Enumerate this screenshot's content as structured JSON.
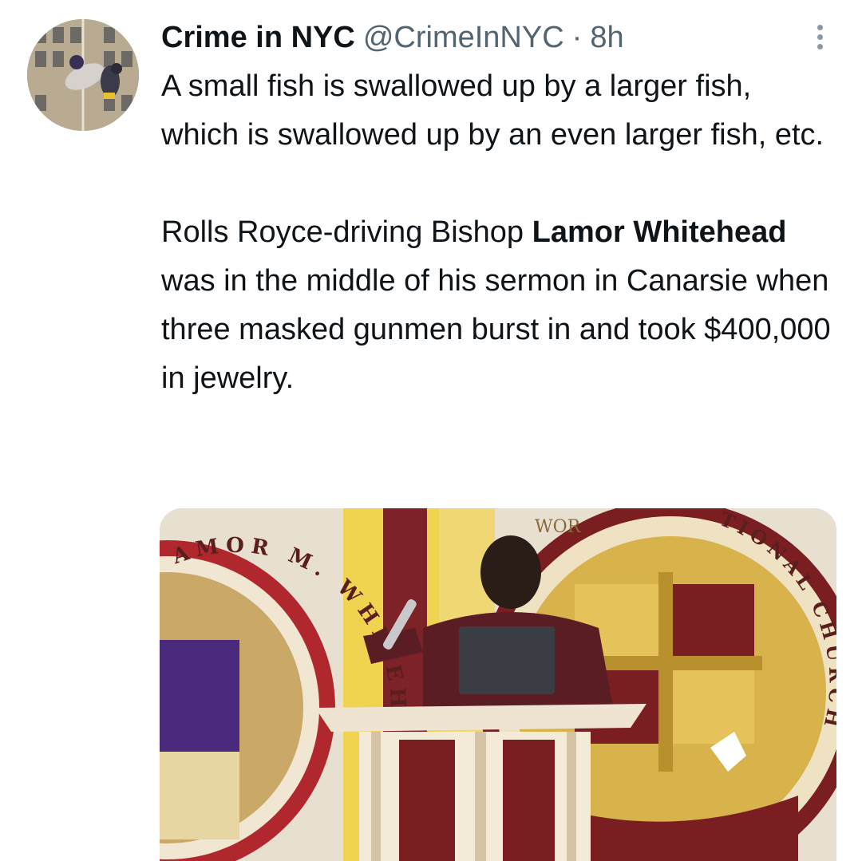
{
  "author": {
    "display_name": "Crime in NYC",
    "handle": "@CrimeInNYC",
    "separator": "·",
    "timestamp": "8h"
  },
  "more_icon": "more-vertical-icon",
  "tweet": {
    "paragraph1": "A small fish is swallowed up by a larger fish, which is swallowed up by an even larger fish, etc.",
    "paragraph2_before": "Rolls Royce-driving Bishop ",
    "paragraph2_bold": "Lamor Whitehead",
    "paragraph2_after": " was in the middle of his sermon in Canarsie when three masked gunmen burst in and took $400,000 in jewelry."
  },
  "media": {
    "seal_left_text": "AMOR M. WHITEHEAD",
    "seal_right_text": "TIONAL CHURCHES",
    "seal_top_text": "WOR"
  },
  "colors": {
    "text": "#0f1419",
    "secondary": "#536471",
    "maroon": "#7a1e22",
    "gold": "#d8b24a"
  }
}
